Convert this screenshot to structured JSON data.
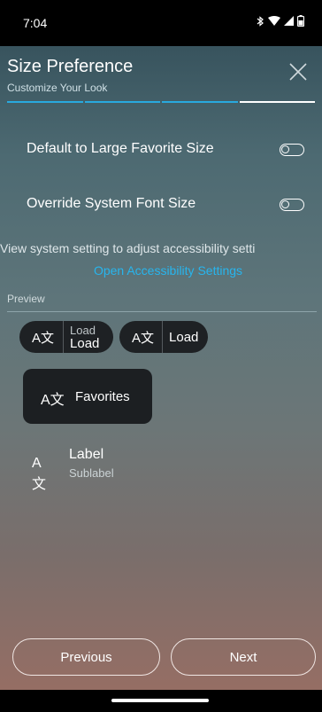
{
  "status": {
    "time": "7:04"
  },
  "header": {
    "title": "Size Preference",
    "subtitle": "Customize Your Look"
  },
  "settings": {
    "large_favorite_label": "Default to Large Favorite Size",
    "override_font_label": "Override System Font Size"
  },
  "info": {
    "text": "View system setting to adjust accessibility setti",
    "link": "Open Accessibility Settings"
  },
  "preview": {
    "label": "Preview",
    "chip1": {
      "line1": "Load",
      "line2": "Load"
    },
    "chip2": {
      "text": "Load"
    },
    "favorite": {
      "text": "Favorites"
    },
    "item": {
      "label": "Label",
      "sublabel": "Sublabel"
    },
    "icon_glyph": "A文"
  },
  "footer": {
    "previous": "Previous",
    "next": "Next"
  },
  "colors": {
    "accent": "#27b5ee",
    "progress_active": "#ffffff",
    "chip_bg": "#1e2124"
  }
}
